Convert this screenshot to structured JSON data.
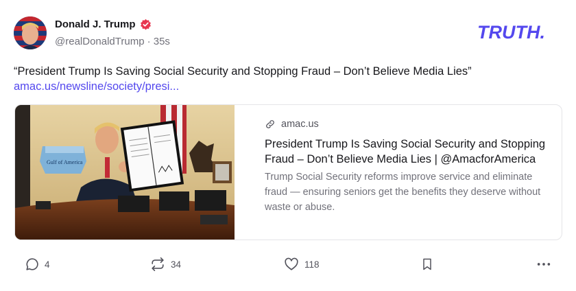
{
  "author": {
    "name": "Donald J. Trump",
    "handle": "@realDonaldTrump",
    "time": "· 35s",
    "verified_icon": "verified-badge-icon",
    "verified_color": "#e8364f"
  },
  "brand": {
    "logo_text": "TRUTH.",
    "color": "#5448ee"
  },
  "post": {
    "text": "“President Trump Is Saving Social Security and Stopping Fraud – Don’t Believe Media Lies”",
    "link_text": "amac.us/newsline/society/presi...",
    "link_color": "#5448ee"
  },
  "link_card": {
    "domain": "amac.us",
    "domain_icon": "link-icon",
    "title": "President Trump Is Saving Social Security and Stopping Fraud – Don’t Believe Media Lies | @AmacforAmerica",
    "description": "Trump Social Security reforms improve service and eliminate fraud — ensuring seniors get the benefits they deserve without waste or abuse.",
    "image_sign_text": "Gulf of America"
  },
  "actions": {
    "reply": {
      "icon": "reply-icon",
      "count": "4"
    },
    "retruth": {
      "icon": "retruth-icon",
      "count": "34"
    },
    "like": {
      "icon": "heart-icon",
      "count": "118"
    },
    "bookmark": {
      "icon": "bookmark-icon"
    },
    "more": {
      "icon": "more-icon"
    }
  }
}
